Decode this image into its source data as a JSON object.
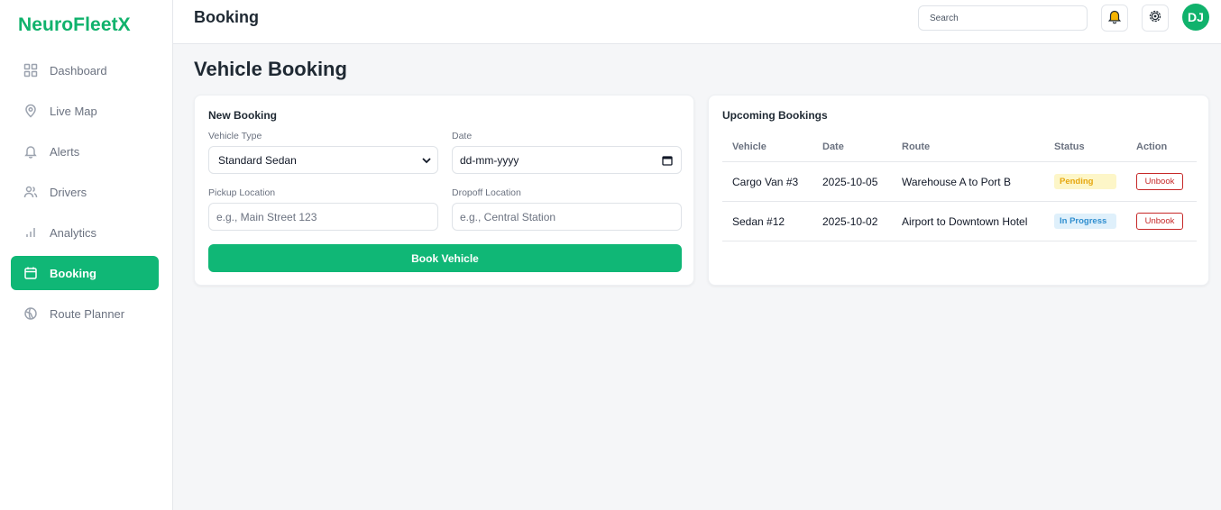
{
  "brand": "NeuroFleetX",
  "sidebar": {
    "items": [
      {
        "label": "Dashboard",
        "icon": "dashboard-grid-icon"
      },
      {
        "label": "Live Map",
        "icon": "map-pin-icon"
      },
      {
        "label": "Alerts",
        "icon": "bell-icon"
      },
      {
        "label": "Drivers",
        "icon": "users-icon"
      },
      {
        "label": "Analytics",
        "icon": "bar-chart-icon"
      },
      {
        "label": "Booking",
        "icon": "calendar-icon",
        "active": true
      },
      {
        "label": "Route Planner",
        "icon": "globe-icon"
      }
    ]
  },
  "header": {
    "title": "Booking",
    "search_placeholder": "Search",
    "avatar_initials": "DJ"
  },
  "page_title": "Vehicle Booking",
  "new_booking": {
    "title": "New Booking",
    "vehicle_type_label": "Vehicle Type",
    "vehicle_type_value": "Standard Sedan",
    "date_label": "Date",
    "date_value": "dd-mm-yyyy",
    "pickup_label": "Pickup Location",
    "pickup_placeholder": "e.g., Main Street 123",
    "dropoff_label": "Dropoff Location",
    "dropoff_placeholder": "e.g., Central Station",
    "submit_label": "Book Vehicle"
  },
  "upcoming": {
    "title": "Upcoming Bookings",
    "columns": [
      "Vehicle",
      "Date",
      "Route",
      "Status",
      "Action"
    ],
    "rows": [
      {
        "vehicle": "Cargo Van #3",
        "date": "2025-10-05",
        "route": "Warehouse A to Port B",
        "status": "Pending",
        "action": "Unbook"
      },
      {
        "vehicle": "Sedan #12",
        "date": "2025-10-02",
        "route": "Airport to Downtown Hotel",
        "status": "In Progress",
        "action": "Unbook"
      }
    ]
  },
  "colors": {
    "accent": "#10b776",
    "pending_text": "#e6a70f",
    "in_progress_text": "#2f8ecf",
    "danger": "#c62828"
  }
}
